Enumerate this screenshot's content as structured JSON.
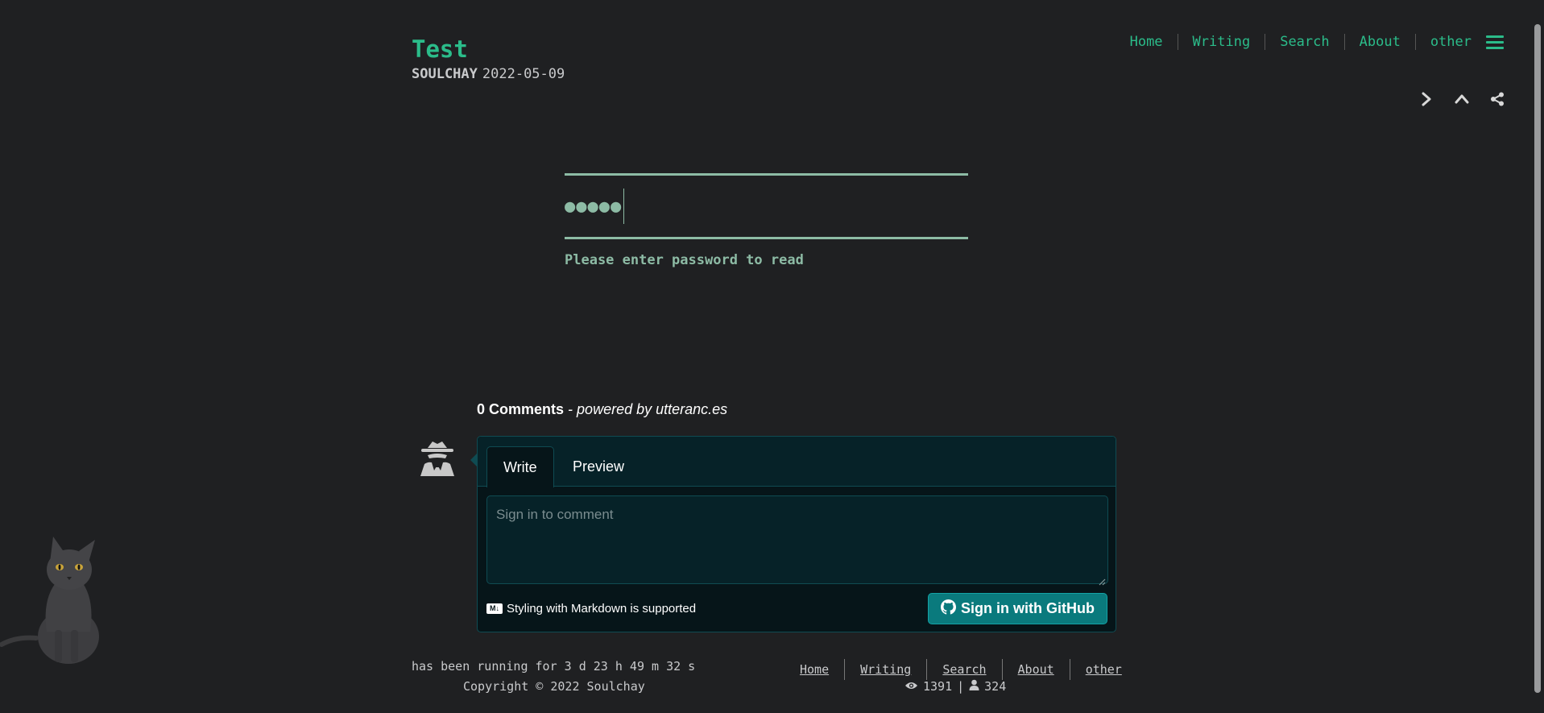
{
  "header": {
    "title": "Test",
    "author": "SOULCHAY",
    "date": "2022-05-09"
  },
  "nav": {
    "items": [
      "Home",
      "Writing",
      "Search",
      "About",
      "other"
    ],
    "menu_icon": "hamburger-menu-icon"
  },
  "post_actions": {
    "icons": [
      "chevron-right-icon",
      "chevron-up-icon",
      "share-icon"
    ]
  },
  "password": {
    "masked_value": "●●●●●",
    "hint": "Please enter password to read"
  },
  "comments": {
    "count_label": "0 Comments",
    "powered_by": "- powered by utteranc.es",
    "tabs": [
      "Write",
      "Preview"
    ],
    "placeholder": "Sign in to comment",
    "markdown_badge": "M↓",
    "markdown_note": "Styling with Markdown is supported",
    "signin_label": "Sign in with GitHub"
  },
  "footer": {
    "runtime": "has been running for 3 d 23 h 49 m 32 s",
    "copyright": "Copyright © 2022 Soulchay",
    "links": [
      "Home",
      "Writing",
      "Search",
      "About",
      "other"
    ],
    "views": "1391",
    "separator": "|",
    "visitors": "324"
  },
  "colors": {
    "accent": "#2bbc8a",
    "background": "#1f2022",
    "comment_bg": "#061519",
    "button": "#0a7a7d"
  }
}
